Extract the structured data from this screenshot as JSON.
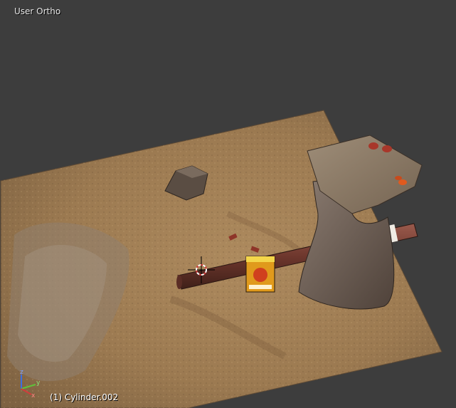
{
  "viewport": {
    "view_name": "User Ortho",
    "active_object": "(1) Cylinder.002",
    "background_color": "#3d3d3d"
  },
  "axis_gizmo": {
    "x_label": "x",
    "y_label": "y",
    "z_label": "z",
    "x_color": "#d23c3c",
    "y_color": "#5fc23a",
    "z_color": "#3d6ee0"
  },
  "scene_objects": {
    "terrain_plane": {
      "color": "#a7845a"
    },
    "rock": {
      "color": "#5a4d43"
    },
    "pipe": {
      "color": "#7a3e33"
    },
    "rock_pillar": {
      "color": "#6f6158"
    },
    "fruit_box": {
      "color": "#e09a1c"
    },
    "cursor_3d": "3d-cursor-icon"
  }
}
